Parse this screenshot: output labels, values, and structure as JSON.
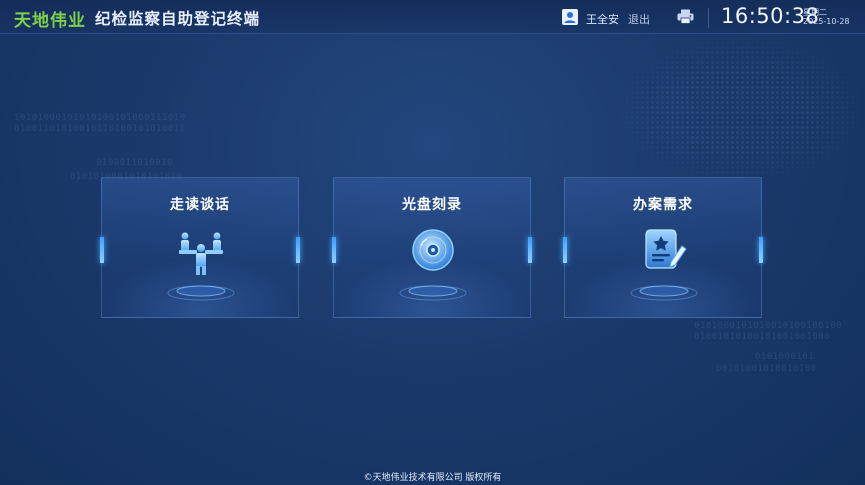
{
  "header": {
    "brand": "天地伟业",
    "title": "纪检监察自助登记终端",
    "user_name": "王全安",
    "logout_label": "退出",
    "time": "16:50:38",
    "weekday": "星期二",
    "date": "2025-10-28"
  },
  "cards": [
    {
      "title": "走读谈话",
      "icon": "meeting-icon"
    },
    {
      "title": "光盘刻录",
      "icon": "disc-icon"
    },
    {
      "title": "办案需求",
      "icon": "document-edit-icon"
    }
  ],
  "footer": {
    "copyright": "©天地伟业技术有限公司 版权所有"
  },
  "colors": {
    "brand": "#7fd14a",
    "background": "#1b3a6c",
    "accent": "#3ea0ff"
  }
}
